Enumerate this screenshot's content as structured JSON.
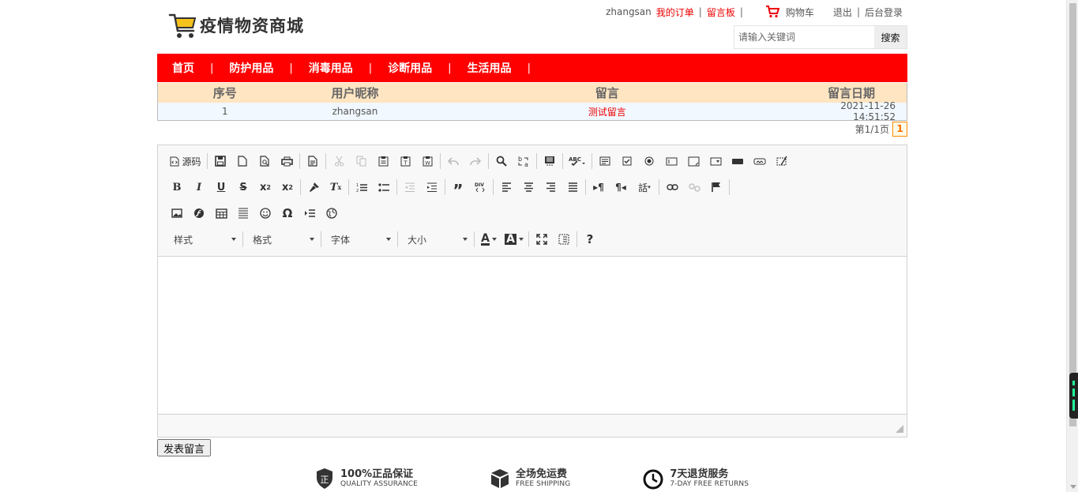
{
  "header": {
    "logo_text": "疫情物资商城",
    "username": "zhangsan",
    "my_orders": "我的订单",
    "message_board": "留言板",
    "cart": "购物车",
    "logout": "退出",
    "admin_login": "后台登录",
    "sep": "|"
  },
  "search": {
    "placeholder": "请输入关键词",
    "button": "搜索"
  },
  "nav": {
    "items": [
      "首页",
      "防护用品",
      "消毒用品",
      "诊断用品",
      "生活用品"
    ],
    "sep": "|"
  },
  "table": {
    "headers": [
      "序号",
      "用户昵称",
      "留言",
      "留言日期"
    ],
    "rows": [
      [
        "1",
        "zhangsan",
        "测试留言",
        "2021-11-26 14:51:52"
      ]
    ]
  },
  "pager": {
    "info": "第1/1页",
    "current": "1"
  },
  "editor": {
    "source_label": "源码",
    "combos": [
      "样式",
      "格式",
      "字体",
      "大小"
    ]
  },
  "submit_button": "发表留言",
  "services": [
    {
      "title": "100%正品保证",
      "subtitle": "QUALITY ASSURANCE",
      "icon": "genuine-shield-icon"
    },
    {
      "title": "全场免运费",
      "subtitle": "FREE SHIPPING",
      "icon": "package-box-icon"
    },
    {
      "title": "7天退货服务",
      "subtitle": "7-DAY FREE RETURNS",
      "icon": "clock-icon"
    }
  ],
  "colors": {
    "nav_bg": "#ff0000",
    "table_header_bg": "#ffe5c1",
    "accent_red": "#ee0000",
    "pager_orange": "#ff7000"
  }
}
